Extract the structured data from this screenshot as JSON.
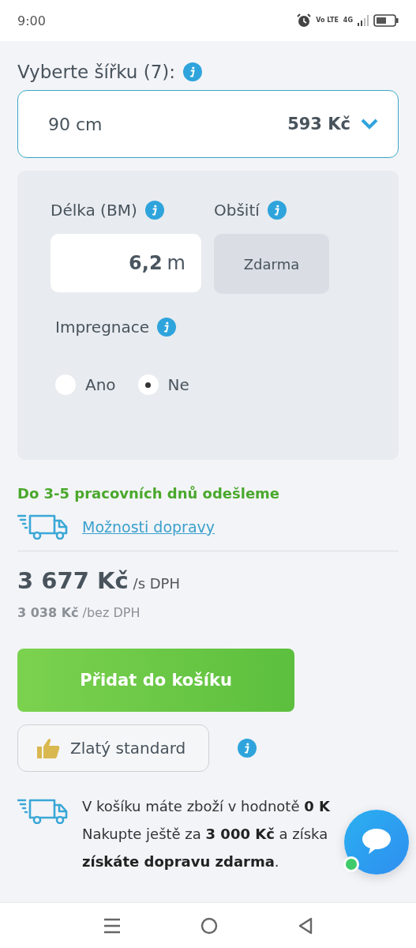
{
  "status_bar": {
    "time": "9:00",
    "network_label": "Vo LTE",
    "network_type": "4G"
  },
  "width_picker": {
    "label": "Vyberte šířku (7):",
    "value": "90 cm",
    "price": "593 Kč"
  },
  "options_panel": {
    "length": {
      "label": "Délka (BM)",
      "value": "6,2",
      "unit": "m"
    },
    "hemming": {
      "label": "Obšití",
      "value": "Zdarma"
    },
    "impregnation": {
      "label": "Impregnace",
      "options": [
        {
          "label": "Ano",
          "selected": false
        },
        {
          "label": "Ne",
          "selected": true
        }
      ]
    }
  },
  "delivery_note": "Do 3-5 pracovních dnů odešleme",
  "shipping_link": "Možnosti dopravy",
  "price": {
    "with_vat": "3 677 Kč",
    "with_vat_suffix": "/s DPH",
    "without_vat": "3 038 Kč",
    "without_vat_suffix": "/bez DPH"
  },
  "add_to_cart_button": "Přidat do košíku",
  "gold_standard_button": "Zlatý standard",
  "free_shipping_lines": [
    "V košíku máte zboží v hodnotě **0 K**",
    "Nakupte ještě za **3 000 Kč** a získa",
    "**získáte dopravu zdarma**."
  ]
}
